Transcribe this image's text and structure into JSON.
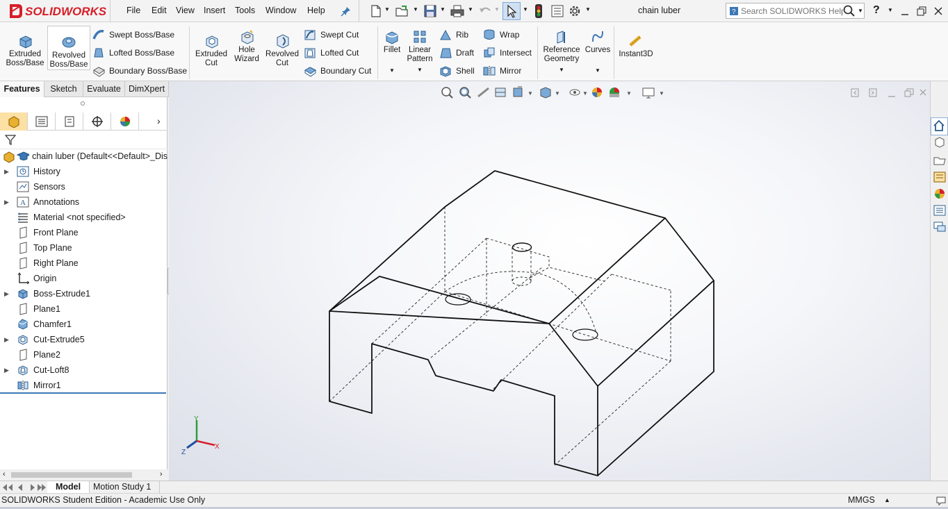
{
  "app": {
    "logo_text": "SOLIDWORKS",
    "document_title": "chain luber",
    "search_placeholder": "Search SOLIDWORKS Help",
    "help_label": "?"
  },
  "menu": [
    "File",
    "Edit",
    "View",
    "Insert",
    "Tools",
    "Window",
    "Help"
  ],
  "ribbon": {
    "extruded_boss": [
      "Extruded",
      "Boss/Base"
    ],
    "revolved_boss": [
      "Revolved",
      "Boss/Base"
    ],
    "swept_boss": "Swept Boss/Base",
    "lofted_boss": "Lofted Boss/Base",
    "boundary_boss": "Boundary Boss/Base",
    "extruded_cut": [
      "Extruded",
      "Cut"
    ],
    "hole_wizard": [
      "Hole",
      "Wizard"
    ],
    "revolved_cut": [
      "Revolved",
      "Cut"
    ],
    "swept_cut": "Swept Cut",
    "lofted_cut": "Lofted Cut",
    "boundary_cut": "Boundary Cut",
    "fillet": "Fillet",
    "linear_pattern": [
      "Linear",
      "Pattern"
    ],
    "rib": "Rib",
    "draft": "Draft",
    "shell": "Shell",
    "wrap": "Wrap",
    "intersect": "Intersect",
    "mirror": "Mirror",
    "reference_geometry": [
      "Reference",
      "Geometry"
    ],
    "curves": "Curves",
    "instant3d": "Instant3D"
  },
  "command_tabs": [
    "Features",
    "Sketch",
    "Evaluate",
    "DimXpert"
  ],
  "tree": {
    "root": "chain luber  (Default<<Default>_Dis",
    "items": [
      {
        "label": "History",
        "expandable": true,
        "icon": "history-icon"
      },
      {
        "label": "Sensors",
        "expandable": false,
        "icon": "sensors-icon"
      },
      {
        "label": "Annotations",
        "expandable": true,
        "icon": "annotations-icon"
      },
      {
        "label": "Material <not specified>",
        "expandable": false,
        "icon": "material-icon"
      },
      {
        "label": "Front Plane",
        "expandable": false,
        "icon": "plane-icon"
      },
      {
        "label": "Top Plane",
        "expandable": false,
        "icon": "plane-icon"
      },
      {
        "label": "Right Plane",
        "expandable": false,
        "icon": "plane-icon"
      },
      {
        "label": "Origin",
        "expandable": false,
        "icon": "origin-icon"
      },
      {
        "label": "Boss-Extrude1",
        "expandable": true,
        "icon": "extrude-icon"
      },
      {
        "label": "Plane1",
        "expandable": false,
        "icon": "plane-icon"
      },
      {
        "label": "Chamfer1",
        "expandable": false,
        "icon": "chamfer-icon"
      },
      {
        "label": "Cut-Extrude5",
        "expandable": true,
        "icon": "cut-extrude-icon"
      },
      {
        "label": "Plane2",
        "expandable": false,
        "icon": "plane-icon"
      },
      {
        "label": "Cut-Loft8",
        "expandable": true,
        "icon": "cut-loft-icon"
      },
      {
        "label": "Mirror1",
        "expandable": false,
        "icon": "mirror-icon"
      }
    ]
  },
  "triad": {
    "x": "X",
    "y": "Y",
    "z": "Z"
  },
  "bottom_tabs": [
    "Model",
    "Motion Study 1"
  ],
  "status": {
    "left": "SOLIDWORKS Student Edition - Academic Use Only",
    "units": "MMGS"
  },
  "colors": {
    "accent_red": "#d71e28",
    "active_tab": "#fce0a4",
    "feature_icon_blue": "#3b78b5"
  }
}
